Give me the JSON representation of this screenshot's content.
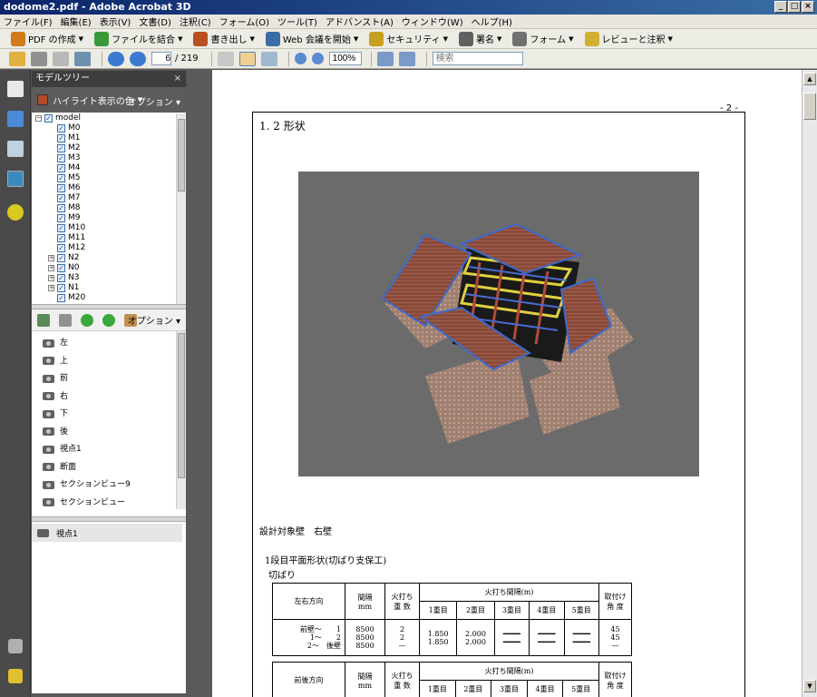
{
  "window": {
    "title": "dodome2.pdf - Adobe Acrobat 3D"
  },
  "menu": [
    "ファイル(F)",
    "編集(E)",
    "表示(V)",
    "文書(D)",
    "注釈(C)",
    "フォーム(O)",
    "ツール(T)",
    "アドバンスト(A)",
    "ウィンドウ(W)",
    "ヘルプ(H)"
  ],
  "toolbar1": [
    {
      "label": "PDF の作成",
      "icon": "create-pdf-icon",
      "color": "#d07a1a"
    },
    {
      "label": "ファイルを結合",
      "icon": "combine-files-icon",
      "color": "#3a9a3a"
    },
    {
      "label": "書き出し",
      "icon": "export-icon",
      "color": "#b85020"
    },
    {
      "label": "Web 会議を開始",
      "icon": "web-meeting-icon",
      "color": "#3a6ea5"
    },
    {
      "label": "セキュリティ",
      "icon": "lock-icon",
      "color": "#c8a020"
    },
    {
      "label": "署名",
      "icon": "pen-icon",
      "color": "#606060"
    },
    {
      "label": "フォーム",
      "icon": "form-icon",
      "color": "#707070"
    },
    {
      "label": "レビューと注釈",
      "icon": "review-icon",
      "color": "#d0b030"
    }
  ],
  "toolbar2": {
    "page_current": "6",
    "page_total": "/ 219",
    "zoom": "100%",
    "search_placeholder": "検索"
  },
  "panel": {
    "title": "モデルツリー",
    "highlight_label": "ハイライト表示の色",
    "options_label": "オプション",
    "views_options_label": "オプション",
    "highlight_color": "#b04a2a"
  },
  "tree": [
    {
      "label": "model",
      "expander": "−",
      "indent": 0
    },
    {
      "label": "M0",
      "indent": 1
    },
    {
      "label": "M1",
      "indent": 1
    },
    {
      "label": "M2",
      "indent": 1
    },
    {
      "label": "M3",
      "indent": 1
    },
    {
      "label": "M4",
      "indent": 1
    },
    {
      "label": "M5",
      "indent": 1
    },
    {
      "label": "M6",
      "indent": 1
    },
    {
      "label": "M7",
      "indent": 1
    },
    {
      "label": "M8",
      "indent": 1
    },
    {
      "label": "M9",
      "indent": 1
    },
    {
      "label": "M10",
      "indent": 1
    },
    {
      "label": "M11",
      "indent": 1
    },
    {
      "label": "M12",
      "indent": 1
    },
    {
      "label": "N2",
      "expander": "+",
      "indent": 1
    },
    {
      "label": "N0",
      "expander": "+",
      "indent": 1
    },
    {
      "label": "N3",
      "expander": "+",
      "indent": 1
    },
    {
      "label": "N1",
      "expander": "+",
      "indent": 1
    },
    {
      "label": "M20",
      "indent": 1
    }
  ],
  "views": [
    "左",
    "上",
    "前",
    "右",
    "下",
    "後",
    "視点1",
    "断面",
    "セクションビュー9",
    "セクションビュー"
  ],
  "selected_view": "視点1",
  "document": {
    "page_number": "- 2 -",
    "section_title": "1. 2 形状",
    "design_target": "設計対象壁　右壁",
    "plan_title": "1段目平面形状(切ばり支保工)",
    "sub_title": "切ばり",
    "table1": {
      "direction": "左右方向",
      "spacing": "間隔",
      "spacing_unit": "mm",
      "fire": "火打ち",
      "count": "重 数",
      "fire_spacing": "火打ち間隔(m)",
      "cols": [
        "1重目",
        "2重目",
        "3重目",
        "4重目",
        "5重目"
      ],
      "angle": "取付け",
      "angle2": "角 度",
      "rows": [
        {
          "label": "前壁～　　1",
          "spacing": "8500",
          "count": "2",
          "v1": "1.850",
          "v2": "2.000",
          "angle": "45"
        },
        {
          "label": "1～　　2",
          "spacing": "8500",
          "count": "2",
          "v1": "1.850",
          "v2": "2.000",
          "angle": "45"
        },
        {
          "label": "2～　後壁",
          "spacing": "8500",
          "count": "—",
          "v1": "",
          "v2": "",
          "angle": "—"
        }
      ]
    },
    "table2": {
      "direction": "前後方向",
      "spacing": "間隔",
      "spacing_unit": "mm",
      "fire": "火打ち",
      "count": "重 数",
      "fire_spacing": "火打ち間隔(m)",
      "cols": [
        "1重目",
        "2重目",
        "3重目",
        "4重目",
        "5重目"
      ],
      "angle": "取付け",
      "angle2": "角 度"
    }
  }
}
